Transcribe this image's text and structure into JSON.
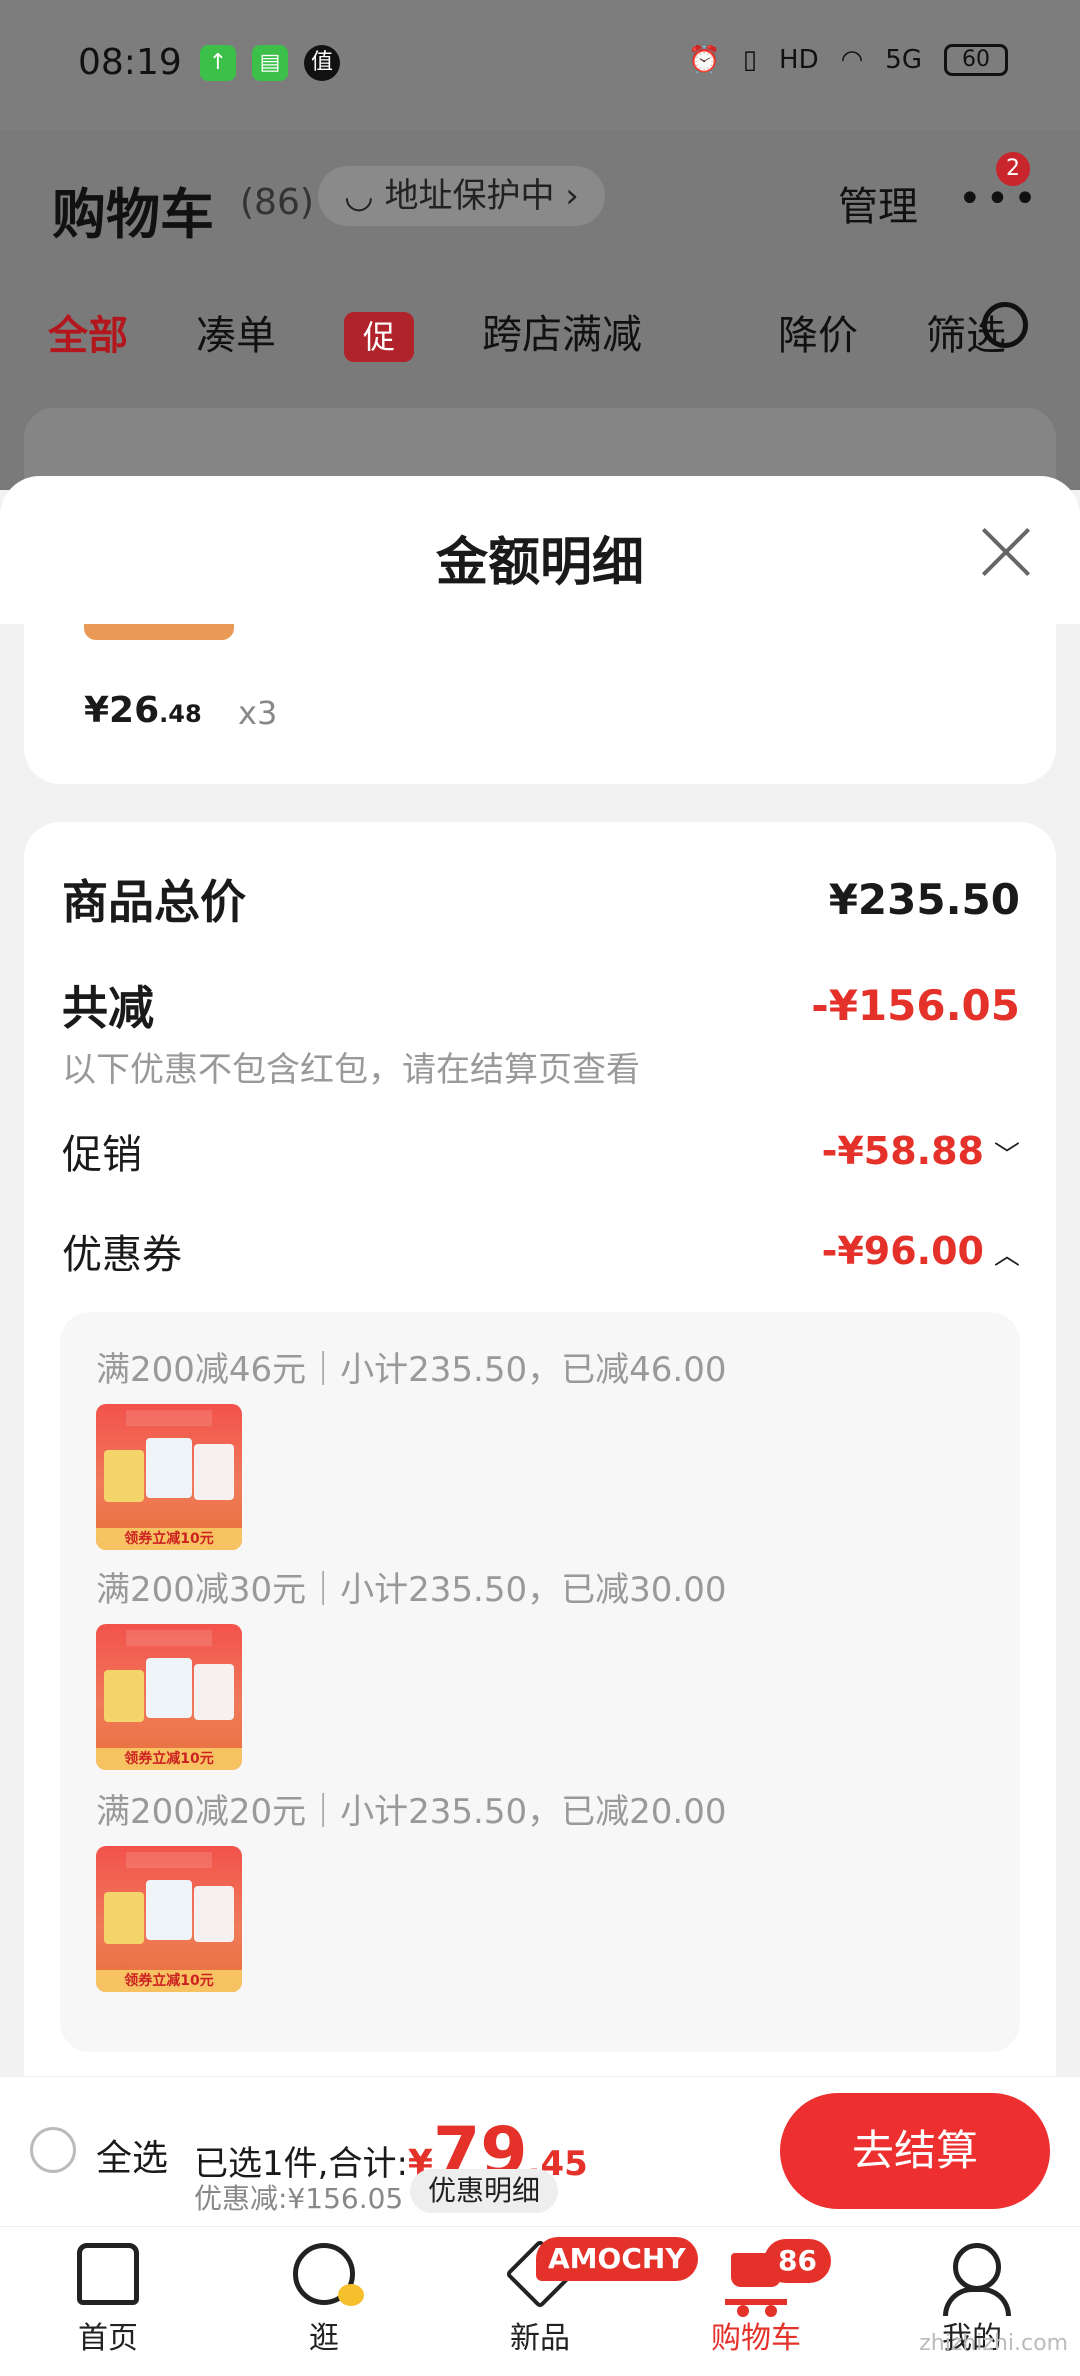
{
  "status_bar": {
    "time": "08:19",
    "icons": [
      "upload-icon",
      "message-icon",
      "zhi-icon"
    ],
    "zhi_glyph": "值",
    "network": "5G",
    "hd": "HD",
    "battery": "60"
  },
  "header": {
    "title": "购物车",
    "count": "(86)",
    "address_label": "地址保护中",
    "manage_label": "管理",
    "more_badge": "2"
  },
  "filter_tabs": {
    "all": "全部",
    "cou": "凑单",
    "promo_tag": "促",
    "cross_store": "跨店满减",
    "price_drop": "降价",
    "filter": "筛选"
  },
  "sheet": {
    "title": "金额明细",
    "prev_item": {
      "price_int": "¥26",
      "price_dec": ".48",
      "qty": "x3"
    },
    "total_label": "商品总价",
    "total_value": "¥235.50",
    "reduce_label": "共减",
    "reduce_value": "-¥156.05",
    "note": "以下优惠不包含红包，请在结算页查看",
    "promo_label": "促销",
    "promo_value": "-¥58.88",
    "coupon_label": "优惠券",
    "coupon_value": "-¥96.00",
    "coupons": [
      {
        "text": "满200减46元｜小计235.50，已减46.00",
        "band": "领券立减10元"
      },
      {
        "text": "满200减30元｜小计235.50，已减30.00",
        "band": "领券立减10元"
      },
      {
        "text": "满200减20元｜小计235.50，已减20.00",
        "band": "领券立减10元"
      }
    ]
  },
  "bottom_bar": {
    "select_all": "全选",
    "selected_prefix": "已选1件,合计:",
    "currency": "¥",
    "total_int": "79",
    "total_dec": ".45",
    "discount": "优惠减:¥156.05",
    "discount_detail": "优惠明细",
    "checkout": "去结算"
  },
  "nav": {
    "home": "首页",
    "guang": "逛",
    "new": "新品",
    "new_badge": "AMOCHY",
    "cart": "购物车",
    "cart_badge": "86",
    "me": "我的"
  },
  "colors": {
    "accent": "#e4312a",
    "checkout": "#ed2f2f"
  },
  "watermark": "zhizhizhi.com"
}
